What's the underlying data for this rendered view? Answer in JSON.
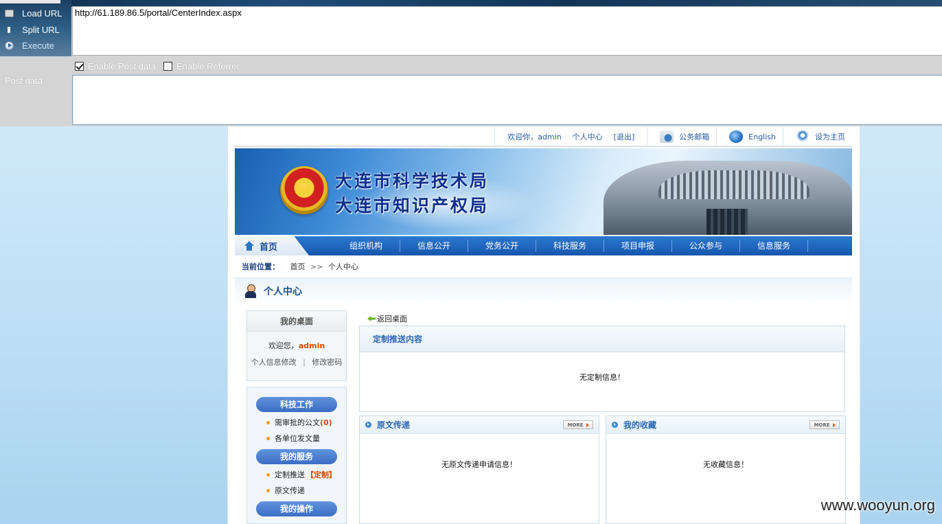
{
  "hackbar": {
    "load_url": "Load URL",
    "split_url": "Split URL",
    "execute": "Execute",
    "url_value": "http://61.189.86.5/portal/CenterIndex.aspx",
    "enable_post": "Enable Post data",
    "enable_referrer": "Enable Referrer",
    "post_label": "Post data",
    "post_value": ""
  },
  "topbar": {
    "welcome": "欢迎你，admin",
    "personal_center": "个人中心",
    "logout": "[退出]",
    "mail": "公务邮箱",
    "english": "English",
    "set_home": "设为主页"
  },
  "banner": {
    "line1": "大连市科学技术局",
    "line2": "大连市知识产权局"
  },
  "nav": {
    "home": "首页",
    "items": [
      "组织机构",
      "信息公开",
      "党务公开",
      "科技服务",
      "项目申报",
      "公众参与",
      "信息服务"
    ]
  },
  "breadcrumb": {
    "label": "当前位置：",
    "home": "首页",
    "sep": ">>",
    "current": "个人中心"
  },
  "uc_title": "个人中心",
  "desk": {
    "title": "我的桌面",
    "welcome_prefix": "欢迎您，",
    "username": "admin",
    "edit_info": "个人信息修改",
    "divider": "|",
    "change_pw": "修改密码"
  },
  "menu": {
    "sec1": "科技工作",
    "sec1_item1": "需审批的公文",
    "sec1_item1_count": "(0)",
    "sec1_item2": "各单位发文量",
    "sec2": "我的服务",
    "sec2_item1": "定制推送",
    "sec2_item1_tag": "【定制】",
    "sec2_item2": "原文传递",
    "sec3": "我的操作"
  },
  "main": {
    "back": "返回桌面",
    "custom_title": "定制推送内容",
    "custom_empty": "无定制信息！",
    "delivery_title": "原文传递",
    "delivery_empty": "无原文传递申请信息！",
    "fav_title": "我的收藏",
    "fav_empty": "无收藏信息！",
    "more": "MORE"
  },
  "watermark": "www.wooyun.org"
}
